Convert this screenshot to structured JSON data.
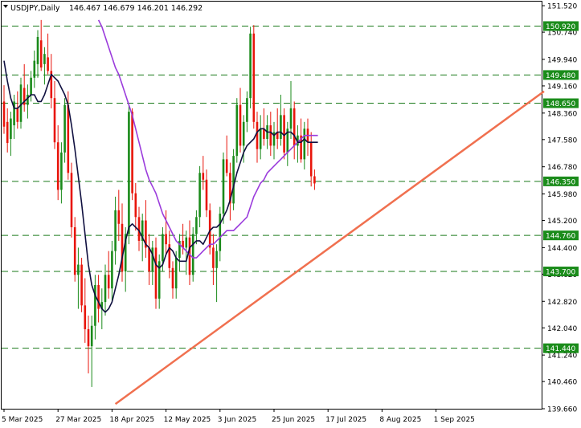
{
  "chart_data": {
    "type": "candlestick",
    "symbol": "USDJPY,Daily",
    "ohlc_header": "146.467 146.679 146.201 146.292",
    "ylim": [
      139.66,
      151.64
    ],
    "y_ticks": [
      "151.520",
      "150.740",
      "149.940",
      "149.160",
      "148.360",
      "147.580",
      "146.780",
      "145.980",
      "145.200",
      "144.400",
      "143.620",
      "142.820",
      "142.040",
      "141.240",
      "140.460",
      "139.660"
    ],
    "x_ticks": [
      {
        "label": "5 Mar 2025",
        "bar": 0
      },
      {
        "label": "27 Mar 2025",
        "bar": 16
      },
      {
        "label": "18 Apr 2025",
        "bar": 32
      },
      {
        "label": "12 May 2025",
        "bar": 48
      },
      {
        "label": "3 Jun 2025",
        "bar": 64
      },
      {
        "label": "25 Jun 2025",
        "bar": 80
      },
      {
        "label": "17 Jul 2025",
        "bar": 96
      },
      {
        "label": "8 Aug 2025",
        "bar": 112
      },
      {
        "label": "1 Sep 2025",
        "bar": 128
      }
    ],
    "levels": [
      {
        "label": "150.920",
        "value": 150.92
      },
      {
        "label": "149.480",
        "value": 149.48
      },
      {
        "label": "148.650",
        "value": 148.65
      },
      {
        "label": "146.350",
        "value": 146.35
      },
      {
        "label": "144.760",
        "value": 144.76
      },
      {
        "label": "143.700",
        "value": 143.7
      },
      {
        "label": "141.440",
        "value": 141.44
      }
    ],
    "trendline": {
      "from": {
        "bar": 33,
        "price": 139.8
      },
      "to": {
        "bar": 160,
        "price": 149.0
      }
    },
    "colors": {
      "up": "#1a8a1a",
      "down": "#e8150b",
      "level_line": "#1a7a1a",
      "level_label_bg": "#1b8c1b",
      "trendline": "#f0704f",
      "ma_fast": "#101040",
      "ma_slow": "#9b3cdc"
    },
    "series": [
      {
        "name": "",
        "role": "ma_fast",
        "values": [
          149.9,
          149.3,
          148.8,
          148.5,
          148.5,
          148.6,
          148.7,
          148.8,
          148.9,
          148.9,
          148.7,
          148.7,
          148.9,
          149.2,
          149.5,
          149.4,
          149.3,
          149.1,
          148.9,
          148.6,
          148.0,
          147.3,
          146.5,
          145.7,
          144.8,
          143.9,
          143.3,
          143.0,
          142.8,
          142.6,
          142.5,
          142.6,
          142.8,
          143.2,
          143.6,
          144.1,
          144.6,
          145.0,
          145.1,
          145.0,
          144.9,
          144.7,
          144.5,
          144.4,
          144.2,
          143.9,
          143.8,
          143.9,
          144.2,
          144.4,
          144.3,
          144.1,
          144.0,
          144.0,
          144.0,
          144.4,
          144.5,
          144.6,
          144.6,
          144.5,
          144.7,
          144.9,
          145.0,
          145.0,
          145.1,
          145.3,
          145.5,
          145.8,
          146.2,
          146.6,
          146.9,
          147.2,
          147.4,
          147.5,
          147.6,
          147.8,
          147.9,
          147.9,
          147.8,
          147.8,
          147.7,
          147.8,
          147.8,
          147.7,
          147.8,
          147.8,
          147.7,
          147.5,
          147.5,
          147.6,
          147.5,
          147.5,
          147.5,
          147.5
        ]
      },
      {
        "name": "",
        "role": "ma_slow",
        "values": [
          151.1,
          150.9,
          150.6,
          150.3,
          150.0,
          149.7,
          149.5,
          149.2,
          148.9,
          148.6,
          148.3,
          147.9,
          147.5,
          147.1,
          146.7,
          146.4,
          146.2,
          146.0,
          145.7,
          145.4,
          145.2,
          145.0,
          144.8,
          144.6,
          144.5,
          144.4,
          144.3,
          144.2,
          144.1,
          144.1,
          144.2,
          144.3,
          144.4,
          144.5,
          144.5,
          144.6,
          144.7,
          144.8,
          144.9,
          144.9,
          144.9,
          145.0,
          145.1,
          145.2,
          145.3,
          145.6,
          145.9,
          146.1,
          146.3,
          146.4,
          146.6,
          146.7,
          146.8,
          146.9,
          147.0,
          147.1,
          147.2,
          147.3,
          147.4,
          147.5,
          147.6,
          147.7,
          147.7,
          147.7,
          147.7,
          147.7
        ]
      },
      {
        "name": "",
        "role": "candles",
        "values": [
          [
            148.7,
            149.18,
            147.75,
            147.96
          ],
          [
            148.1,
            148.5,
            147.2,
            147.48
          ],
          [
            147.6,
            148.4,
            147.1,
            148.2
          ],
          [
            148.0,
            148.9,
            147.6,
            148.7
          ],
          [
            148.5,
            149.0,
            147.9,
            148.1
          ],
          [
            148.1,
            149.4,
            147.9,
            149.2
          ],
          [
            149.1,
            149.8,
            148.4,
            148.6
          ],
          [
            148.6,
            149.2,
            148.2,
            148.9
          ],
          [
            148.9,
            149.6,
            148.7,
            149.4
          ],
          [
            149.4,
            150.2,
            149.1,
            149.9
          ],
          [
            149.8,
            150.8,
            149.4,
            150.6
          ],
          [
            150.5,
            151.1,
            149.6,
            149.7
          ],
          [
            149.8,
            150.3,
            149.2,
            150.1
          ],
          [
            150.0,
            150.7,
            149.5,
            149.6
          ],
          [
            149.6,
            150.1,
            148.5,
            148.8
          ],
          [
            148.8,
            149.3,
            147.3,
            147.5
          ],
          [
            147.5,
            148.0,
            145.8,
            146.1
          ],
          [
            146.1,
            147.5,
            145.7,
            147.2
          ],
          [
            147.2,
            148.8,
            146.9,
            148.6
          ],
          [
            148.6,
            149.0,
            146.4,
            146.6
          ],
          [
            146.6,
            146.9,
            144.7,
            145.0
          ],
          [
            145.0,
            145.3,
            143.4,
            143.6
          ],
          [
            143.6,
            144.4,
            142.6,
            143.9
          ],
          [
            143.9,
            144.1,
            142.5,
            142.7
          ],
          [
            142.7,
            143.5,
            141.6,
            142.0
          ],
          [
            142.0,
            142.4,
            140.7,
            141.5
          ],
          [
            141.5,
            142.4,
            140.3,
            142.1
          ],
          [
            142.1,
            143.6,
            141.7,
            143.3
          ],
          [
            143.3,
            143.6,
            142.2,
            142.6
          ],
          [
            142.6,
            143.2,
            142.0,
            142.8
          ],
          [
            142.8,
            143.9,
            142.4,
            143.6
          ],
          [
            143.6,
            144.3,
            142.9,
            143.2
          ],
          [
            143.2,
            144.6,
            142.8,
            144.3
          ],
          [
            144.3,
            145.9,
            143.9,
            145.5
          ],
          [
            145.5,
            146.1,
            144.6,
            145.1
          ],
          [
            145.1,
            145.7,
            143.4,
            143.7
          ],
          [
            143.7,
            145.0,
            143.1,
            144.8
          ],
          [
            144.8,
            148.6,
            144.5,
            148.4
          ],
          [
            148.4,
            148.5,
            145.8,
            146.0
          ],
          [
            146.0,
            146.3,
            144.9,
            145.3
          ],
          [
            145.3,
            145.6,
            144.3,
            144.6
          ],
          [
            144.6,
            145.4,
            144.0,
            145.2
          ],
          [
            145.2,
            145.8,
            144.1,
            144.4
          ],
          [
            144.4,
            144.8,
            143.3,
            143.7
          ],
          [
            143.7,
            144.6,
            143.3,
            144.4
          ],
          [
            144.4,
            144.7,
            142.6,
            142.9
          ],
          [
            142.9,
            144.2,
            142.6,
            144.0
          ],
          [
            144.0,
            145.0,
            143.7,
            144.8
          ],
          [
            144.8,
            145.5,
            144.2,
            144.5
          ],
          [
            144.5,
            144.9,
            143.5,
            143.8
          ],
          [
            143.8,
            144.0,
            142.9,
            143.2
          ],
          [
            143.2,
            144.3,
            142.9,
            144.1
          ],
          [
            144.1,
            144.8,
            143.7,
            144.6
          ],
          [
            144.6,
            145.1,
            144.2,
            144.4
          ],
          [
            144.4,
            144.9,
            143.6,
            144.7
          ],
          [
            144.7,
            145.2,
            143.3,
            143.6
          ],
          [
            143.6,
            145.0,
            143.4,
            144.8
          ],
          [
            144.8,
            145.5,
            144.5,
            145.3
          ],
          [
            145.3,
            146.8,
            145.0,
            146.6
          ],
          [
            146.6,
            147.1,
            146.1,
            146.4
          ],
          [
            146.4,
            146.7,
            145.3,
            145.5
          ],
          [
            145.5,
            145.7,
            144.2,
            144.4
          ],
          [
            144.4,
            144.8,
            143.3,
            143.8
          ],
          [
            143.8,
            144.5,
            142.8,
            144.3
          ],
          [
            144.3,
            145.6,
            144.0,
            145.4
          ],
          [
            145.4,
            147.2,
            145.1,
            147.0
          ],
          [
            147.0,
            147.7,
            146.5,
            146.6
          ],
          [
            146.6,
            146.9,
            145.2,
            145.7
          ],
          [
            145.7,
            147.3,
            145.5,
            147.1
          ],
          [
            147.1,
            148.8,
            146.9,
            148.6
          ],
          [
            148.6,
            149.1,
            147.2,
            147.4
          ],
          [
            147.4,
            148.3,
            146.9,
            148.1
          ],
          [
            148.1,
            149.0,
            147.8,
            148.8
          ],
          [
            148.8,
            150.9,
            148.5,
            150.7
          ],
          [
            150.7,
            150.95,
            147.9,
            148.1
          ],
          [
            148.1,
            148.4,
            146.9,
            147.3
          ],
          [
            147.3,
            148.3,
            147.0,
            147.9
          ],
          [
            147.9,
            148.5,
            147.4,
            147.6
          ],
          [
            147.6,
            148.3,
            147.3,
            148.0
          ],
          [
            148.0,
            148.4,
            147.1,
            147.4
          ],
          [
            147.4,
            148.1,
            147.0,
            147.8
          ],
          [
            147.8,
            148.5,
            147.3,
            147.6
          ],
          [
            147.6,
            148.9,
            147.4,
            148.3
          ],
          [
            148.3,
            148.5,
            147.0,
            147.2
          ],
          [
            147.2,
            148.1,
            146.8,
            147.9
          ],
          [
            147.9,
            149.3,
            147.6,
            148.5
          ],
          [
            148.5,
            148.7,
            147.0,
            147.4
          ],
          [
            147.4,
            148.0,
            146.9,
            147.7
          ],
          [
            147.7,
            148.2,
            146.9,
            147.0
          ],
          [
            147.0,
            148.1,
            146.7,
            147.9
          ],
          [
            147.9,
            148.2,
            147.1,
            147.5
          ],
          [
            147.5,
            147.8,
            146.2,
            146.5
          ],
          [
            146.5,
            146.7,
            146.1,
            146.29
          ]
        ]
      }
    ]
  }
}
